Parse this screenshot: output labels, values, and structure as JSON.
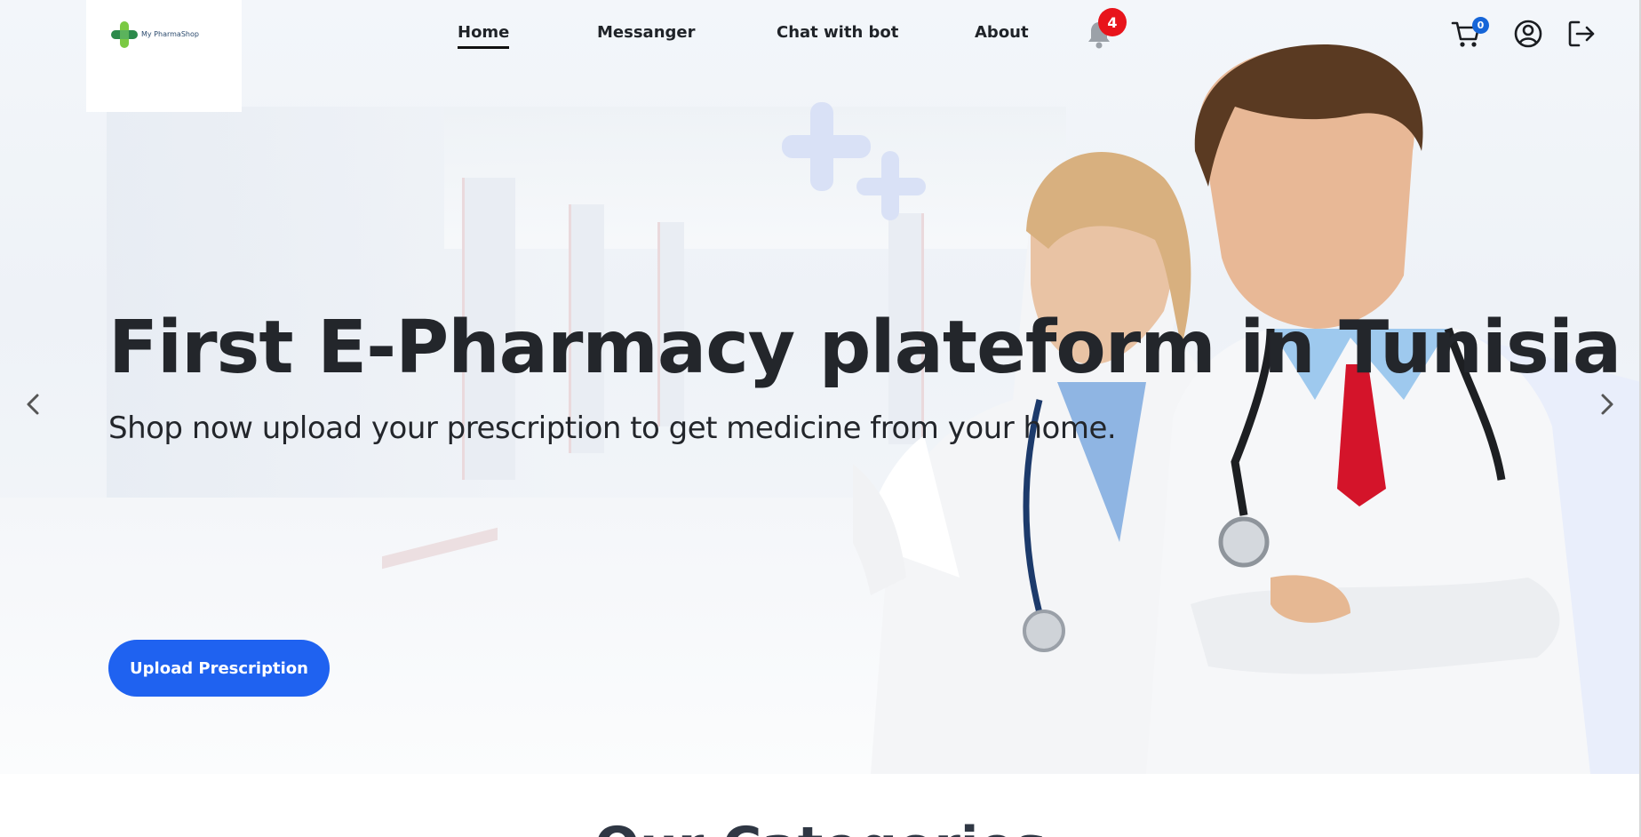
{
  "logo": {
    "text": "My PharmaShop"
  },
  "nav": {
    "links": [
      {
        "label": "Home",
        "active": true
      },
      {
        "label": "Messanger"
      },
      {
        "label": "Chat with bot"
      },
      {
        "label": "About"
      }
    ],
    "notifications_count": "4",
    "cart_count": "0"
  },
  "hero": {
    "title": "First E-Pharmacy plateform in Tunisia",
    "subtitle": "Shop now upload your prescription to get medicine from your home.",
    "cta_label": "Upload Prescription"
  },
  "next_section": {
    "title": "Our Categories"
  },
  "icons": {
    "bell": "bell-icon",
    "cart": "cart-icon",
    "user": "user-circle-icon",
    "logout": "logout-icon",
    "prev": "chevron-left-icon",
    "next": "chevron-right-icon"
  },
  "colors": {
    "primary": "#1f62f0",
    "badge_red": "#e8141b",
    "badge_blue": "#1565d8",
    "text_dark": "#23262b"
  }
}
